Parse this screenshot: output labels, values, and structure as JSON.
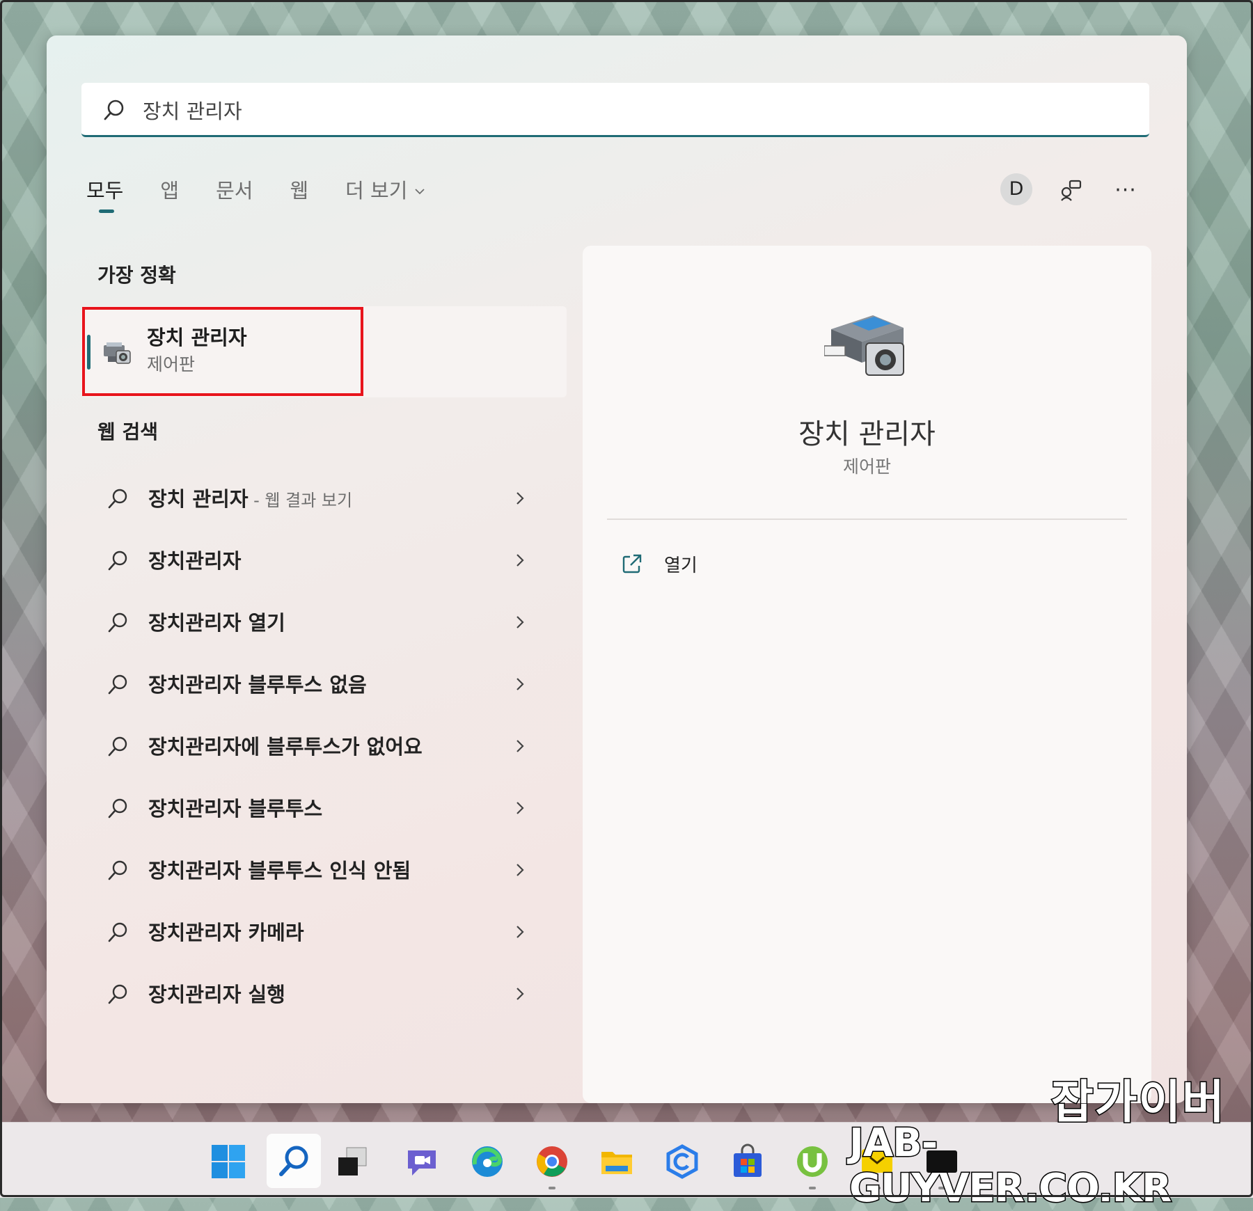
{
  "search": {
    "value": "장치 관리자",
    "placeholder": ""
  },
  "tabs": [
    {
      "label": "모두",
      "active": true
    },
    {
      "label": "앱"
    },
    {
      "label": "문서"
    },
    {
      "label": "웹"
    },
    {
      "label": "더 보기"
    }
  ],
  "header": {
    "avatar_letter": "D",
    "share_icon": "connections-icon",
    "more_label": "···"
  },
  "best_match": {
    "section_label": "가장 정확",
    "title": "장치 관리자",
    "subtitle": "제어판",
    "icon": "device-manager-icon"
  },
  "web_search": {
    "section_label": "웹 검색",
    "items": [
      {
        "text": "장치 관리자",
        "suffix": " - 웹 결과 보기"
      },
      {
        "text": "장치관리자",
        "suffix": ""
      },
      {
        "text": "장치관리자 열기",
        "suffix": ""
      },
      {
        "text": "장치관리자 블루투스 없음",
        "suffix": ""
      },
      {
        "text": "장치관리자에 블루투스가 없어요",
        "suffix": ""
      },
      {
        "text": "장치관리자 블루투스",
        "suffix": ""
      },
      {
        "text": "장치관리자 블루투스 인식 안됨",
        "suffix": ""
      },
      {
        "text": "장치관리자 카메라",
        "suffix": ""
      },
      {
        "text": "장치관리자 실행",
        "suffix": ""
      }
    ]
  },
  "detail": {
    "title": "장치 관리자",
    "subtitle": "제어판",
    "open_label": "열기"
  },
  "taskbar": {
    "icons": [
      "windows-start-icon",
      "search-icon",
      "task-view-icon",
      "chat-icon",
      "edge-icon",
      "chrome-icon",
      "file-explorer-icon",
      "app-icon",
      "store-icon",
      "utorrent-icon",
      "messenger-icon",
      "terminal-icon"
    ]
  },
  "watermark": {
    "ko": "잡가이버",
    "en": "JAB-GUYVER.CO.KR"
  },
  "colors": {
    "accent": "#1f6b75",
    "highlight": "#e8141c"
  }
}
